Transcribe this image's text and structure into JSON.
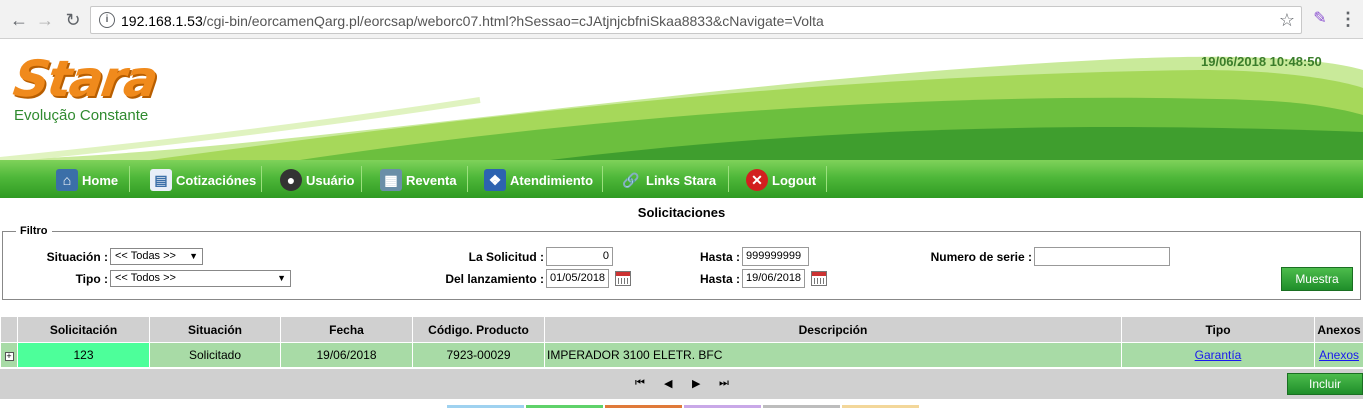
{
  "browser": {
    "url_host": "192.168.1.53",
    "url_path": "/cgi-bin/eorcamenQarg.pl/eorcsap/weborc07.html?hSessao=cJAtjnjcbfniSkaa8833&cNavigate=Volta",
    "icons": [
      "back-icon",
      "forward-icon",
      "reload-icon",
      "info-icon",
      "star-icon",
      "extension-icon",
      "menu-icon"
    ]
  },
  "banner": {
    "logo_text": "Stara",
    "tagline": "Evolução Constante",
    "datetime": "19/06/2018 10:48:50"
  },
  "menu": [
    {
      "label": "Home",
      "icon": "home-icon"
    },
    {
      "label": "Cotizaciónes",
      "icon": "document-icon"
    },
    {
      "label": "Usuário",
      "icon": "user-icon"
    },
    {
      "label": "Reventa",
      "icon": "store-icon"
    },
    {
      "label": "Atendimiento",
      "icon": "service-icon"
    },
    {
      "label": "Links Stara",
      "icon": "link-icon"
    },
    {
      "label": "Logout",
      "icon": "logout-icon"
    }
  ],
  "page_title": "Solicitaciones",
  "filter": {
    "legend": "Filtro",
    "situacion_label": "Situación :",
    "situacion_value": "<< Todas >>",
    "tipo_label": "Tipo :",
    "tipo_value": "<< Todos >>",
    "solicitud_label": "La Solicitud :",
    "solicitud_value": "0",
    "hasta1_label": "Hasta :",
    "hasta1_value": "999999999",
    "lanzamiento_label": "Del lanzamiento :",
    "lanzamiento_value": "01/05/2018",
    "hasta2_label": "Hasta :",
    "hasta2_value": "19/06/2018",
    "serie_label": "Numero de serie :",
    "serie_value": "",
    "muestra_label": "Muestra"
  },
  "grid": {
    "headers": [
      "Solicitación",
      "Situación",
      "Fecha",
      "Código. Producto",
      "Descripción",
      "Tipo",
      "Anexos"
    ],
    "rows": [
      {
        "expander": "+",
        "solicitacion": "123",
        "situacion": "Solicitado",
        "fecha": "19/06/2018",
        "codigo": "7923-00029",
        "descripcion": "IMPERADOR 3100 ELETR. BFC",
        "tipo": "Garantía",
        "anexos": "Anexos"
      }
    ],
    "pager": {
      "first": "⏮",
      "prev": "◀",
      "next": "▶",
      "last": "⏭"
    },
    "incluir_label": "Incluir"
  },
  "colors": {
    "brand_orange": "#f08a1c",
    "brand_green": "#4fb83a",
    "row_green": "#a8dba6",
    "highlight": "#4dff9a"
  }
}
